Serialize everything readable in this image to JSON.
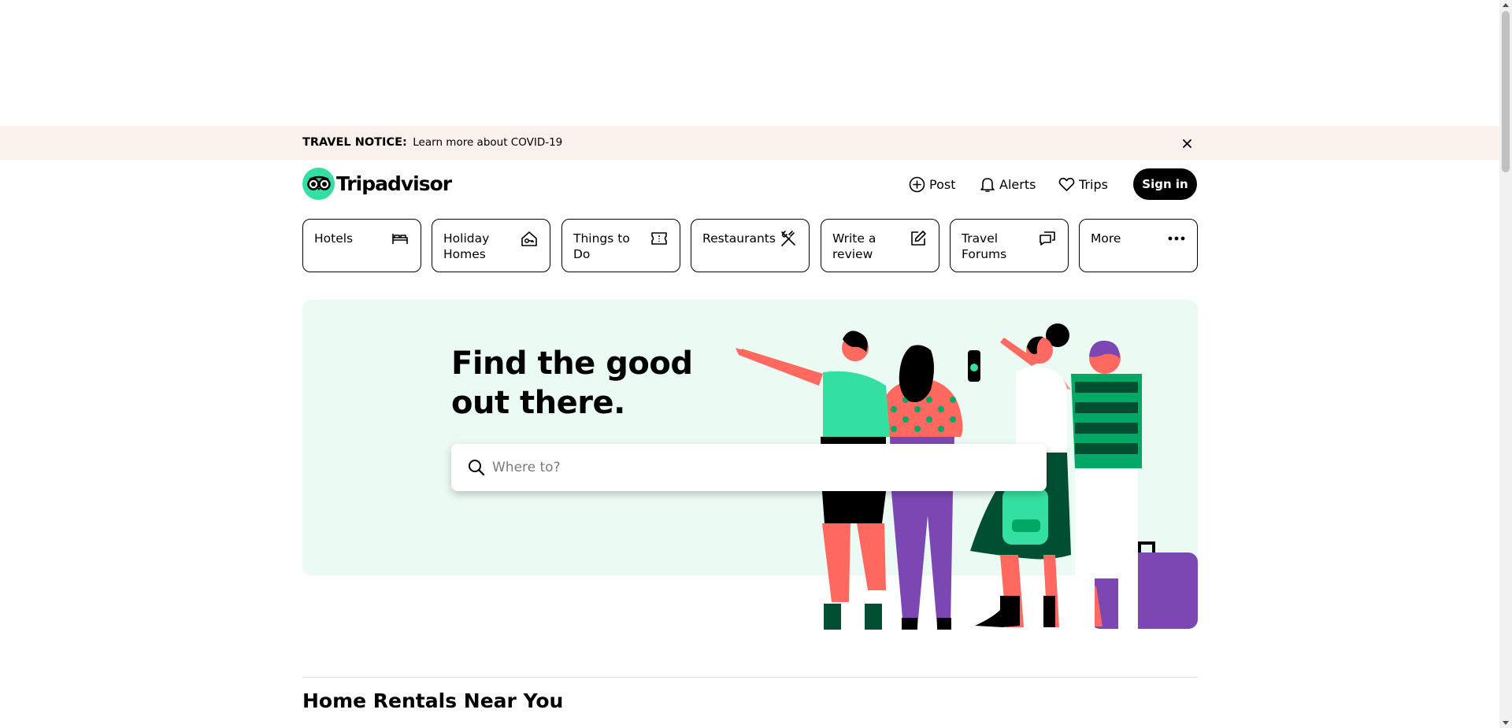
{
  "notice": {
    "title": "TRAVEL NOTICE:",
    "link": "Learn more about COVID-19"
  },
  "header": {
    "logo_text": "Tripadvisor",
    "post": "Post",
    "alerts": "Alerts",
    "trips": "Trips",
    "sign_in": "Sign in"
  },
  "nav": {
    "items": [
      {
        "label": "Hotels",
        "icon": "bed-icon"
      },
      {
        "label": "Holiday Homes",
        "icon": "house-key-icon"
      },
      {
        "label": "Things to Do",
        "icon": "ticket-icon"
      },
      {
        "label": "Restaurants",
        "icon": "fork-knife-icon"
      },
      {
        "label": "Write a review",
        "icon": "edit-icon"
      },
      {
        "label": "Travel Forums",
        "icon": "chat-bubbles-icon"
      },
      {
        "label": "More",
        "icon": "more-dots-icon"
      }
    ]
  },
  "hero": {
    "title": "Find the good out there.",
    "search_placeholder": "Where to?"
  },
  "sections": {
    "home_rentals_title": "Home Rentals Near You"
  },
  "colors": {
    "brand_green": "#34e0a1",
    "hero_background": "#ebfaf3",
    "notice_background": "#faf1ed"
  }
}
